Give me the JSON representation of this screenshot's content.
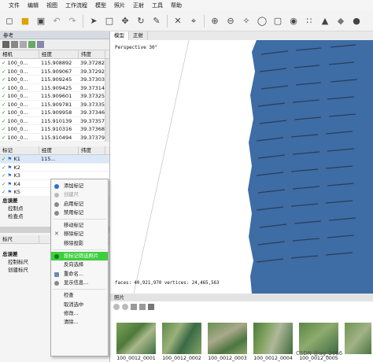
{
  "menu": [
    "文件",
    "编辑",
    "视图",
    "工作流程",
    "模型",
    "照片",
    "正射",
    "工具",
    "帮助"
  ],
  "reference": {
    "title": "参考",
    "camera_columns": [
      "相机",
      "经度",
      "纬度"
    ],
    "cameras": [
      {
        "name": "100_0...",
        "lon": "115.908892",
        "lat": "39.37282"
      },
      {
        "name": "100_0...",
        "lon": "115.909067",
        "lat": "39.37292"
      },
      {
        "name": "100_0...",
        "lon": "115.909245",
        "lat": "39.37303"
      },
      {
        "name": "100_0...",
        "lon": "115.909425",
        "lat": "39.37314"
      },
      {
        "name": "100_0...",
        "lon": "115.909601",
        "lat": "39.37325"
      },
      {
        "name": "100_0...",
        "lon": "115.909781",
        "lat": "39.37335"
      },
      {
        "name": "100_0...",
        "lon": "115.909958",
        "lat": "39.37346"
      },
      {
        "name": "100_0...",
        "lon": "115.910139",
        "lat": "39.37357"
      },
      {
        "name": "100_0...",
        "lon": "115.910316",
        "lat": "39.37368"
      },
      {
        "name": "100_0...",
        "lon": "115.910494",
        "lat": "39.37379"
      }
    ],
    "marker_columns": [
      "标记",
      "经度",
      "纬度"
    ],
    "markers": [
      {
        "name": "K1",
        "lon": "115..."
      },
      {
        "name": "K2",
        "lon": ""
      },
      {
        "name": "K3",
        "lon": ""
      },
      {
        "name": "K4",
        "lon": ""
      },
      {
        "name": "K5",
        "lon": ""
      }
    ],
    "total_error": "总误差",
    "control_points": "控制点",
    "check_points": "检查点",
    "scalebar_columns": [
      "标尺"
    ],
    "scalebar_total": "总误差",
    "control_scalebars": "控制标尺",
    "check_scalebars": "创建标尺"
  },
  "context_menu": {
    "items": [
      {
        "label": "添加标记",
        "disabled": false
      },
      {
        "label": "创建尺",
        "disabled": true
      },
      {
        "label": "启用标记",
        "disabled": false
      },
      {
        "label": "禁用标记",
        "disabled": false
      },
      {
        "label": "移动标记",
        "disabled": false
      },
      {
        "label": "移除标记",
        "disabled": false
      },
      {
        "label": "移除投影",
        "disabled": false
      },
      {
        "label": "按标记筛选照片",
        "disabled": false,
        "highlight": true
      },
      {
        "label": "反向选择",
        "disabled": false
      },
      {
        "label": "重命名...",
        "disabled": false
      },
      {
        "label": "显示信息...",
        "disabled": false
      },
      {
        "label": "检查",
        "disabled": false
      },
      {
        "label": "取消选中",
        "disabled": false
      },
      {
        "label": "修改...",
        "disabled": false
      },
      {
        "label": "清除...",
        "disabled": false
      }
    ]
  },
  "view": {
    "tabs": [
      "模型",
      "正射"
    ],
    "perspective": "Perspective 30°",
    "stats": "faces: 40,921,970 vertices: 24,465,563",
    "model_color": "#3e6ca5"
  },
  "photos": {
    "title": "照片",
    "labels": [
      "100_0012_0001",
      "100_0012_0002",
      "100_0012_0003",
      "100_0012_0004",
      "100_0012_0005"
    ]
  },
  "watermark": "CSDN @ag_2666"
}
